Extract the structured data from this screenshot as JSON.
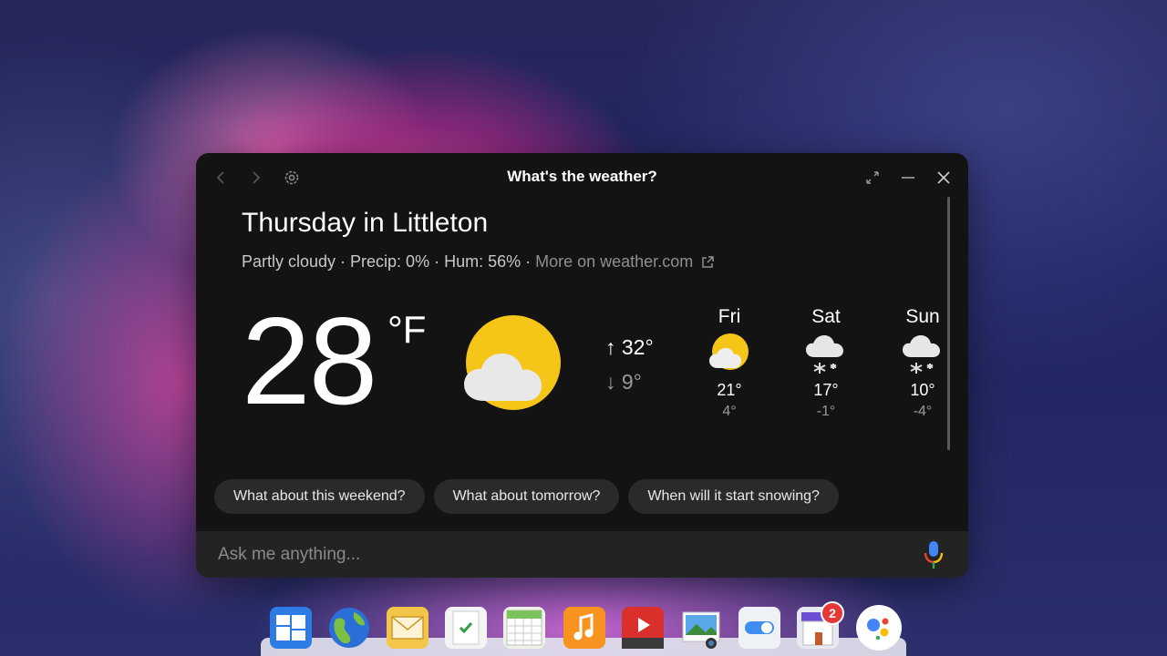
{
  "window": {
    "title": "What's the weather?"
  },
  "weather": {
    "heading": "Thursday in Littleton",
    "summary": "Partly cloudy · Precip: 0% · Hum: 56% · ",
    "more_link": "More on weather.com",
    "temperature": "28",
    "unit": "°F",
    "condition_icon": "partly-cloudy-icon",
    "high": "↑ 32°",
    "low": "↓ 9°",
    "forecast": [
      {
        "day": "Fri",
        "icon": "partly-sunny-icon",
        "high": "21°",
        "low": "4°"
      },
      {
        "day": "Sat",
        "icon": "snow-icon",
        "high": "17°",
        "low": "-1°"
      },
      {
        "day": "Sun",
        "icon": "snow-icon",
        "high": "10°",
        "low": "-4°"
      }
    ]
  },
  "suggestions": [
    "What about this weekend?",
    "What about tomorrow?",
    "When will it start snowing?"
  ],
  "input": {
    "placeholder": "Ask me anything..."
  },
  "shelf": {
    "apps": [
      {
        "icon": "launcher-tiles-icon"
      },
      {
        "icon": "browser-globe-icon"
      },
      {
        "icon": "mail-envelope-icon"
      },
      {
        "icon": "tasks-check-icon"
      },
      {
        "icon": "calendar-grid-icon"
      },
      {
        "icon": "music-note-icon"
      },
      {
        "icon": "video-play-icon"
      },
      {
        "icon": "photos-icon"
      },
      {
        "icon": "settings-toggle-icon"
      },
      {
        "icon": "store-icon",
        "badge": "2"
      },
      {
        "icon": "assistant-icon"
      }
    ]
  },
  "colors": {
    "window_bg": "#131313",
    "chip_bg": "#2a2a2a",
    "sun": "#f5c518",
    "mic_blue": "#4285f4",
    "mic_red": "#ea4335",
    "mic_yellow": "#fbbc05"
  }
}
